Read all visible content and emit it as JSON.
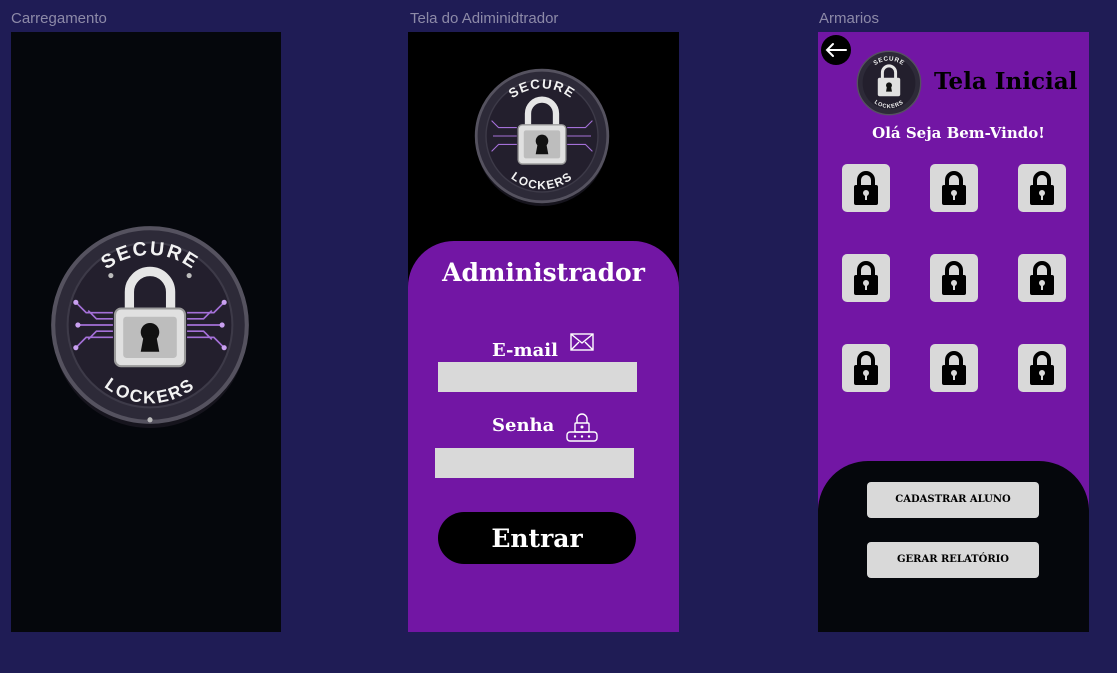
{
  "frames": [
    {
      "label": "Carregamento"
    },
    {
      "label": "Tela do Adiminidtrador"
    },
    {
      "label": "Armarios"
    }
  ],
  "logo": {
    "top_text": "SECURE",
    "bottom_text": "LOCKERS"
  },
  "admin": {
    "title": "Administrador",
    "email_label": "E-mail",
    "email_value": "",
    "password_label": "Senha",
    "password_value": "",
    "submit_label": "Entrar"
  },
  "lockers_screen": {
    "title": "Tela Inicial",
    "welcome": "Olá Seja Bem-Vindo!",
    "locker_count": 9,
    "register_button": "CADASTRAR ALUNO",
    "report_button": "GERAR RELATÓRIO"
  },
  "colors": {
    "canvas": "#1f1c55",
    "brand_purple": "#7216a4",
    "dark": "#05070c",
    "field": "#d9d9d9"
  },
  "icons": [
    "back-arrow-icon",
    "mail-icon",
    "password-lock-icon",
    "padlock-icon"
  ]
}
